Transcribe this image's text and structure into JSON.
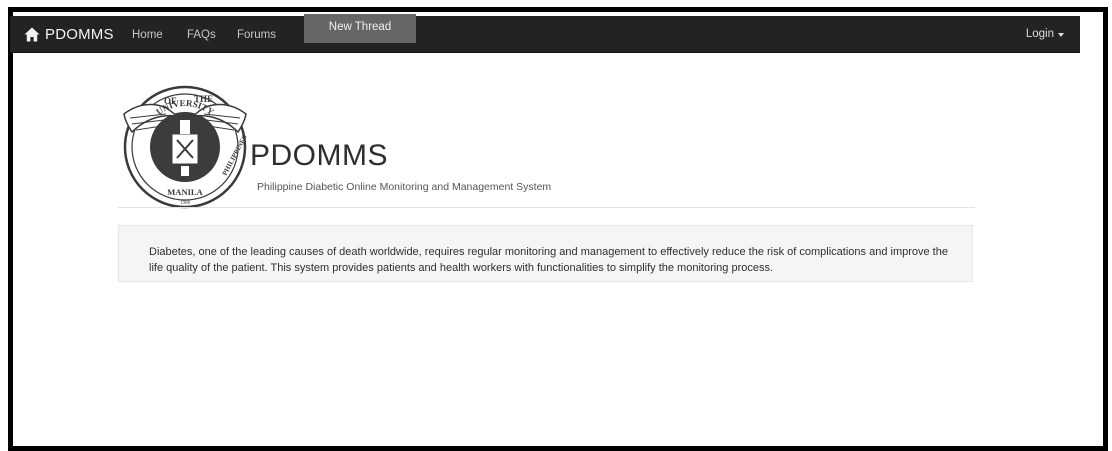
{
  "navbar": {
    "brand_label": "PDOMMS",
    "brand_icon": "home-icon",
    "links": [
      "Home",
      "FAQs",
      "Forums"
    ],
    "new_thread_label": "New Thread",
    "login_label": "Login"
  },
  "header": {
    "seal_icon": "university-seal-icon",
    "seal_text": {
      "top_left": "OF",
      "top_right": "THE",
      "left": "UNIVERSITY",
      "right": "PHILIPPINES",
      "bottom": "MANILA",
      "year": "1908"
    },
    "title": "PDOMMS",
    "subtitle": "Philippine Diabetic Online Monitoring and Management System"
  },
  "intro": {
    "text": "Diabetes, one of the leading causes of death worldwide, requires regular monitoring and management to effectively reduce the risk of complications and improve the life quality of the patient. This system provides patients and health workers with functionalities to simplify the monitoring process."
  },
  "colors": {
    "navbar_bg": "#232323",
    "active_tab_bg": "#666666",
    "well_bg": "#f5f5f5",
    "frame_border": "#000000"
  }
}
